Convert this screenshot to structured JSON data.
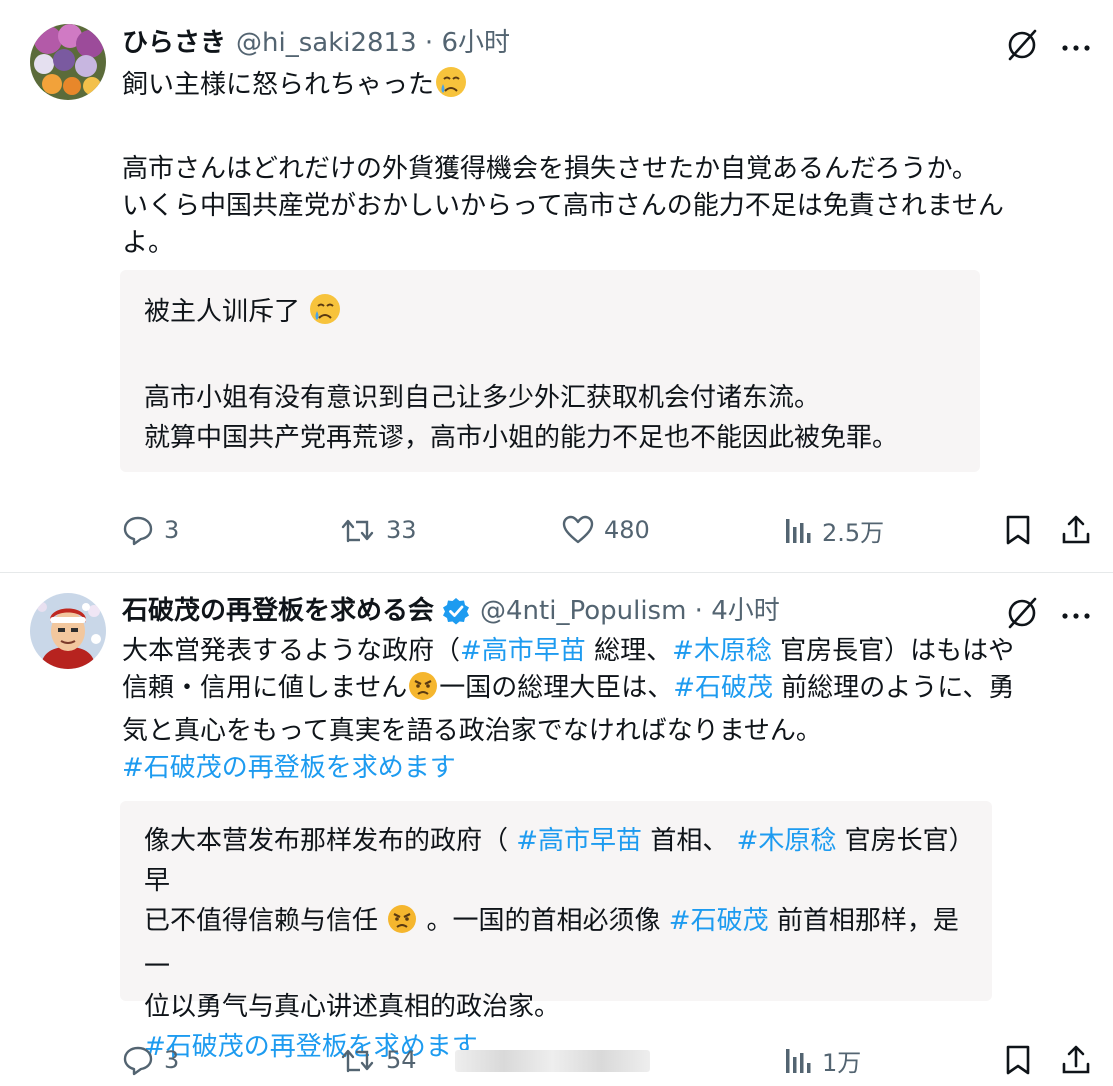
{
  "tweets": [
    {
      "display_name": "ひらさき",
      "meta": "@hi_saki2813 · 6小时",
      "text_line1": "飼い主様に怒られちゃった",
      "text_line2": "高市さんはどれだけの外貨獲得機会を損失させたか自覚あるんだろうか。",
      "text_line3": "いくら中国共産党がおかしいからって高市さんの能力不足は免責されません",
      "text_line4": "よ。",
      "translation_line1": "被主人训斥了",
      "translation_line2": "高市小姐有没有意识到自己让多少外汇获取机会付诸东流。",
      "translation_line3": "就算中国共产党再荒谬，高市小姐的能力不足也不能因此被免罪。",
      "replies": "3",
      "reposts": "33",
      "likes": "480",
      "views": "2.5万"
    },
    {
      "display_name": "石破茂の再登板を求める会",
      "meta": "@4nti_Populism · 4小时",
      "text_l1_a": "大本営発表するような政府（",
      "text_l1_tag1": "#高市早苗",
      "text_l1_b": " 総理、",
      "text_l1_tag2": "#木原稔",
      "text_l1_c": " 官房長官）はもはや",
      "text_l2_a": "信頼・信用に値しません",
      "text_l2_b": "一国の総理大臣は、",
      "text_l2_tag": "#石破茂",
      "text_l2_c": " 前総理のように、勇",
      "text_l3": "気と真心をもって真実を語る政治家でなければなりません。",
      "text_l4_tag": "#石破茂の再登板を求めます",
      "tr_l1_a": "像大本营发布那样发布的政府（ ",
      "tr_l1_tag1": "#高市早苗",
      "tr_l1_b": " 首相、 ",
      "tr_l1_tag2": "#木原稔",
      "tr_l1_c": " 官房长官）早",
      "tr_l2_a": "已不值得信赖与信任 ",
      "tr_l2_b": " 。一国的首相必须像 ",
      "tr_l2_tag": "#石破茂",
      "tr_l2_c": " 前首相那样，是一",
      "tr_l3": "位以勇气与真心讲述真相的政治家。",
      "tr_l4_tag": " #石破茂の再登板を求めます",
      "replies": "3",
      "reposts": "54",
      "views": "1万"
    }
  ],
  "colors": {
    "link": "#1d9bf0",
    "muted": "#536471",
    "translation_bg": "#f7f5f5"
  },
  "icons": [
    "grok-icon",
    "more-icon",
    "reply-icon",
    "repost-icon",
    "like-icon",
    "views-icon",
    "bookmark-icon",
    "share-icon",
    "verified-badge-icon"
  ]
}
